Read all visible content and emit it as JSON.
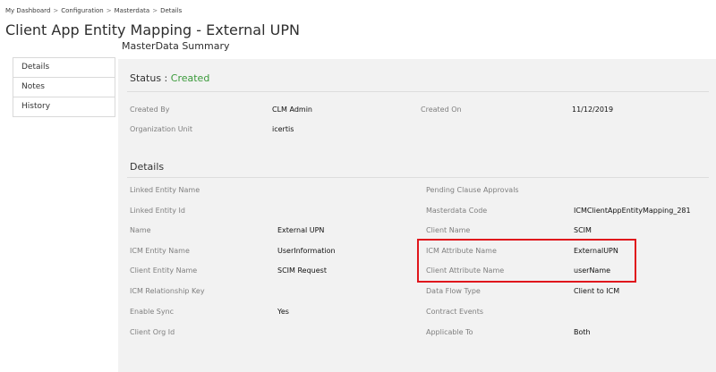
{
  "breadcrumb": [
    "My Dashboard",
    "Configuration",
    "Masterdata",
    "Details"
  ],
  "breadcrumb_separator": ">",
  "page_title": "Client App Entity Mapping - External UPN",
  "subtitle": "MasterData Summary",
  "nav": {
    "items": [
      {
        "label": "Details"
      },
      {
        "label": "Notes"
      },
      {
        "label": "History"
      }
    ]
  },
  "status": {
    "label": "Status :",
    "value": "Created",
    "value_color": "#3a9a3a"
  },
  "summary": {
    "created_by_label": "Created By",
    "created_by_value": "CLM Admin",
    "created_on_label": "Created On",
    "created_on_value": "11/12/2019",
    "org_unit_label": "Organization Unit",
    "org_unit_value": "icertis"
  },
  "details": {
    "heading": "Details",
    "left_fields": [
      {
        "label": "Linked Entity Name",
        "value": ""
      },
      {
        "label": "Linked Entity Id",
        "value": ""
      },
      {
        "label": "Name",
        "value": "External UPN"
      },
      {
        "label": "ICM Entity Name",
        "value": "UserInformation"
      },
      {
        "label": "Client Entity Name",
        "value": "SCIM Request"
      },
      {
        "label": "ICM Relationship Key",
        "value": ""
      },
      {
        "label": "Enable Sync",
        "value": "Yes"
      },
      {
        "label": "Client Org Id",
        "value": ""
      }
    ],
    "right_fields": [
      {
        "label": "Pending Clause Approvals",
        "value": ""
      },
      {
        "label": "Masterdata Code",
        "value": "ICMClientAppEntityMapping_281"
      },
      {
        "label": "Client Name",
        "value": "SCIM"
      },
      {
        "label": "ICM Attribute Name",
        "value": "ExternalUPN"
      },
      {
        "label": "Client Attribute Name",
        "value": "userName"
      },
      {
        "label": "Data Flow Type",
        "value": "Client to ICM"
      },
      {
        "label": "Contract Events",
        "value": ""
      },
      {
        "label": "Applicable To",
        "value": "Both"
      }
    ]
  },
  "colors": {
    "highlight_border": "#e0161c",
    "panel_background": "#f2f2f2"
  }
}
